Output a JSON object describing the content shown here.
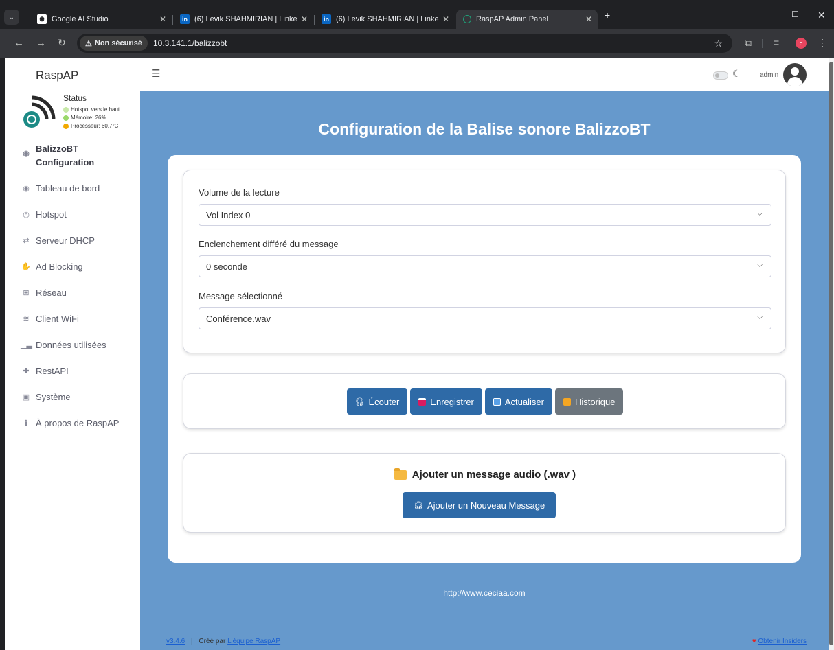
{
  "browser": {
    "tabs": [
      {
        "label": "Google AI Studio",
        "active": false
      },
      {
        "label": "(6) Levik SHAHMIRIAN | Linked",
        "active": false
      },
      {
        "label": "(6) Levik SHAHMIRIAN | Linked",
        "active": false
      },
      {
        "label": "RaspAP Admin Panel",
        "active": true
      }
    ],
    "security_label": "Non sécurisé",
    "url": "10.3.141.1/balizzobt",
    "profile_initial": "c"
  },
  "sidebar": {
    "brand": "RaspAP",
    "status": {
      "title": "Status",
      "hotspot": "Hotspot vers le haut",
      "memory": "Mémoire: 26%",
      "cpu": "Processeur: 60.7°C"
    },
    "items": [
      {
        "label": "BalizzoBT Configuration",
        "line1": "BalizzoBT",
        "line2": "Configuration",
        "icon": "dashboard-icon",
        "active": true
      },
      {
        "label": "Tableau de bord",
        "icon": "dashboard-icon"
      },
      {
        "label": "Hotspot",
        "icon": "hotspot-icon"
      },
      {
        "label": "Serveur DHCP",
        "icon": "exchange-icon"
      },
      {
        "label": "Ad Blocking",
        "icon": "hand-icon"
      },
      {
        "label": "Réseau",
        "icon": "network-icon"
      },
      {
        "label": "Client WiFi",
        "icon": "wifi-icon"
      },
      {
        "label": "Données utilisées",
        "icon": "chart-icon"
      },
      {
        "label": "RestAPI",
        "icon": "puzzle-icon"
      },
      {
        "label": "Système",
        "icon": "hdd-icon"
      },
      {
        "label": "À propos de RaspAP",
        "icon": "info-icon"
      }
    ]
  },
  "topbar": {
    "user": "admin"
  },
  "main": {
    "title": "Configuration de la Balise sonore BalizzoBT",
    "fields": [
      {
        "label": "Volume de la lecture",
        "value": "Vol Index 0"
      },
      {
        "label": "Enclenchement différé du message",
        "value": "0 seconde"
      },
      {
        "label": "Message sélectionné",
        "value": "Conférence.wav"
      }
    ],
    "buttons": {
      "listen": "Écouter",
      "save": "Enregistrer",
      "refresh": "Actualiser",
      "history": "Historique"
    },
    "add_section": {
      "title": "Ajouter un message audio (.wav )",
      "button": "Ajouter un Nouveau Message"
    },
    "footer_url": "http://www.ceciaa.com"
  },
  "footer": {
    "version": "v3.4.6",
    "separator": "|",
    "credit_prefix": "Créé par",
    "credit_link": "L'équipe RaspAP",
    "insiders": "Obtenir Insiders"
  },
  "colors": {
    "content_bg": "#6699cc",
    "primary_button": "#2e6aa7",
    "secondary_button": "#6c757d",
    "status_ok": "#9ad86a",
    "status_warn": "#f2a900"
  }
}
